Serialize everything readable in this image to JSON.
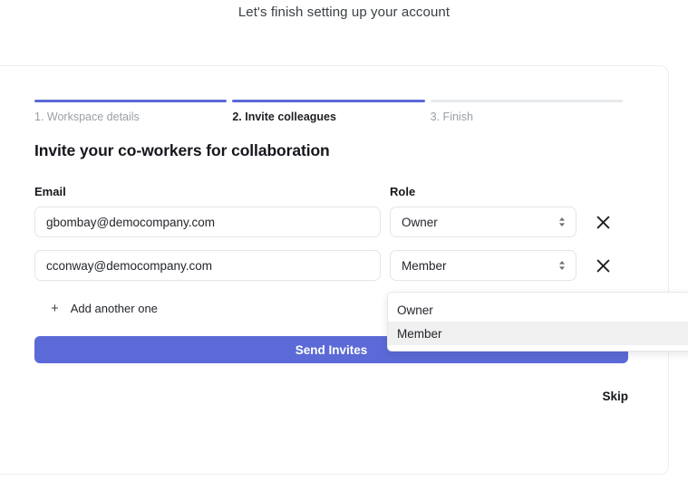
{
  "page": {
    "heading": "Let's finish setting up your account"
  },
  "stepper": {
    "steps": [
      {
        "label": "1. Workspace details",
        "state": "done"
      },
      {
        "label": "2. Invite colleagues",
        "state": "active"
      },
      {
        "label": "3. Finish",
        "state": "upcoming"
      }
    ]
  },
  "form": {
    "section_title": "Invite your co-workers for collaboration",
    "email_label": "Email",
    "role_label": "Role",
    "email_placeholder": "",
    "rows": [
      {
        "email": "gbombay@democompany.com",
        "role": "Owner"
      },
      {
        "email": "cconway@democompany.com",
        "role": "Member"
      }
    ],
    "add_another_label": "Add another one",
    "add_icon": "plus-icon",
    "remove_icon": "close-icon",
    "select_icon": "up-down-stepper-icon",
    "submit_label": "Send Invites",
    "skip_label": "Skip"
  },
  "role_dropdown": {
    "open": true,
    "options": [
      {
        "label": "Owner",
        "highlighted": false
      },
      {
        "label": "Member",
        "highlighted": true
      }
    ]
  },
  "colors": {
    "accent": "#5b6ad6",
    "track": "#e8eaed",
    "highlight": "#f0f0f0",
    "text": "#15171c",
    "muted": "#9aa0a6"
  }
}
